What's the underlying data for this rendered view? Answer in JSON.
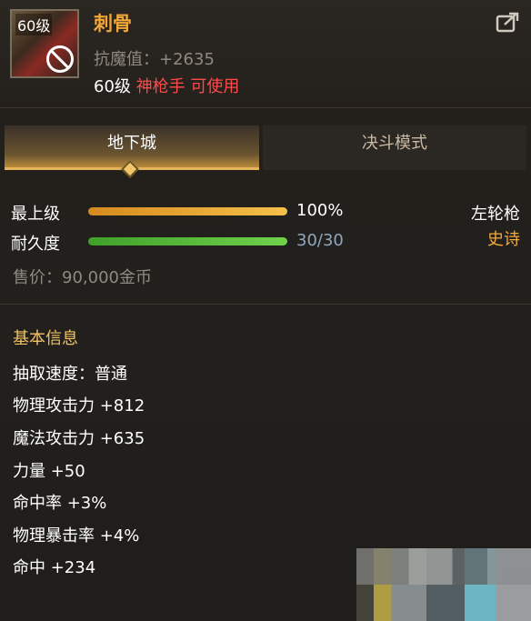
{
  "item": {
    "level_badge": "60级",
    "name": "刺骨",
    "resist": "抗魔值：+2635",
    "req_level": "60级",
    "req_class": "神枪手 可使用"
  },
  "tabs": [
    {
      "label": "地下城",
      "active": true
    },
    {
      "label": "决斗模式",
      "active": false
    }
  ],
  "bars": {
    "grade_label": "最上级",
    "grade_value": "100%",
    "grade_fraction": 1.0,
    "durability_label": "耐久度",
    "durability_value": "30/30",
    "durability_fraction": 1.0
  },
  "weapon_type": "左轮枪",
  "rarity": "史诗",
  "price": "售价：90,000金币",
  "section_title": "基本信息",
  "stats": [
    "抽取速度：普通",
    "物理攻击力 +812",
    "魔法攻击力 +635",
    "力量 +50",
    "命中率 +3%",
    "物理暴击率 +4%",
    "命中 +234"
  ],
  "colors": {
    "name": "#f2a83a",
    "class_req": "#ff4a4a",
    "rarity": "#f5a93a",
    "section": "#f1c266",
    "grade_bar": "#f5c04a",
    "durability_bar": "#6fd24b"
  },
  "icons": {
    "share": "share-external-icon",
    "unusable": "prohibited-icon"
  }
}
